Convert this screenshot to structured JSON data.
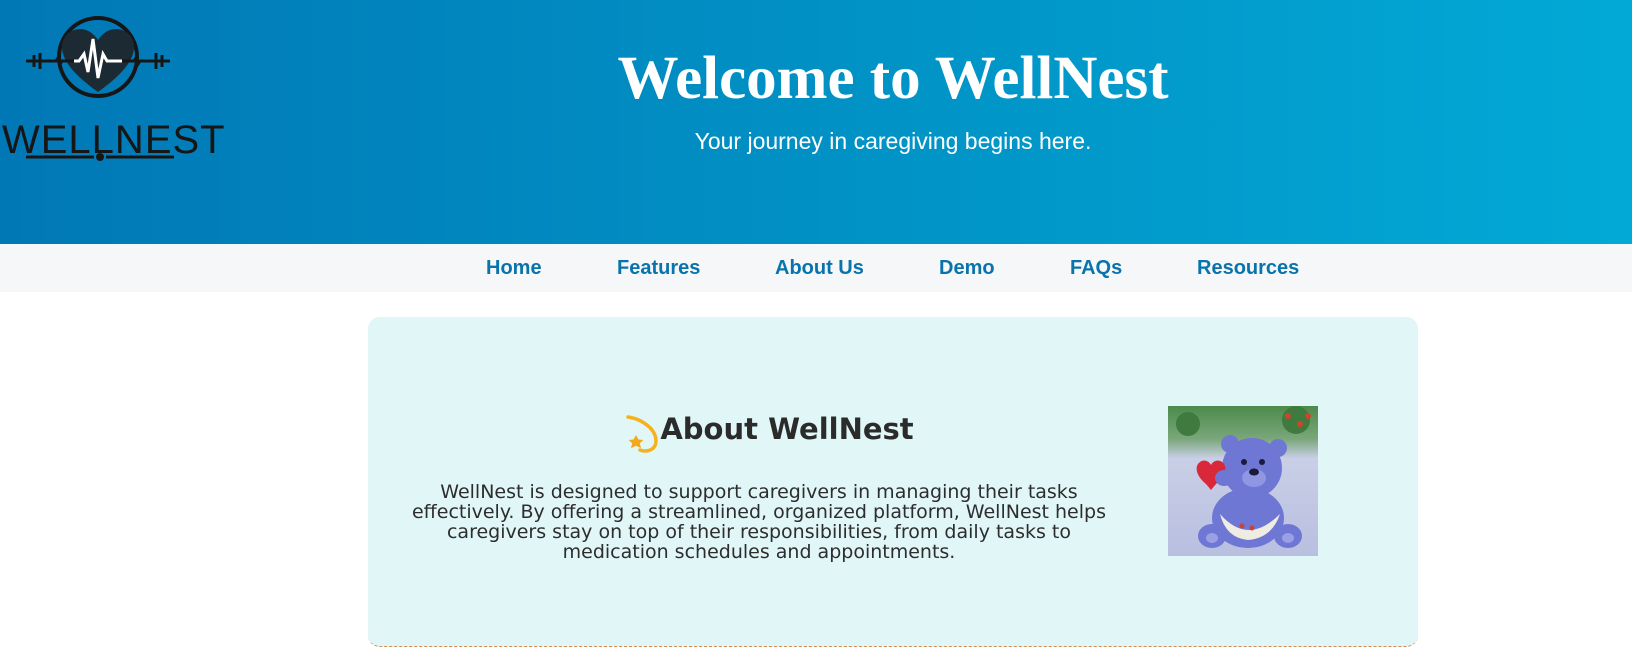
{
  "logo": {
    "wordmark": "WELLNEST",
    "icon": "heart-pulse-icon",
    "colors": {
      "mark": "#161616",
      "heart": "#1c2b33"
    }
  },
  "header": {
    "title": "Welcome to WellNest",
    "tagline": "Your journey in caregiving begins here.",
    "gradient_start": "#0178b6",
    "gradient_end": "#02a9d6"
  },
  "nav": {
    "items": [
      {
        "label": "Home"
      },
      {
        "label": "Features"
      },
      {
        "label": "About Us"
      },
      {
        "label": "Demo"
      },
      {
        "label": "FAQs"
      },
      {
        "label": "Resources"
      }
    ],
    "link_color": "#0973ad"
  },
  "about": {
    "heading": "About WellNest",
    "heading_icon": "shooting-star-icon",
    "body": "WellNest is designed to support caregivers in managing their tasks effectively. By offering a streamlined, organized platform, WellNest helps caregivers stay on top of their responsibilities, from daily tasks to medication schedules and appointments.",
    "image": "care-bear-image",
    "card_color": "#e0f6f7"
  }
}
